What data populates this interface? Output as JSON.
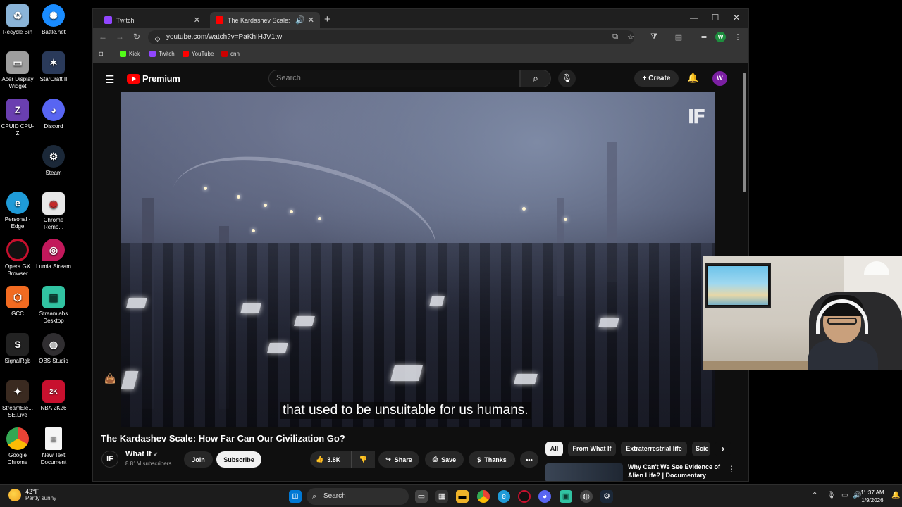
{
  "desktop": {
    "icons_left": [
      {
        "label": "Recycle Bin",
        "icon": "recycle-bin-icon",
        "color": "#8ab4d8"
      },
      {
        "label": "Acer Display Widget",
        "icon": "acer-display-widget-icon",
        "color": "#9e9e9e"
      },
      {
        "label": "CPUID CPU-Z",
        "icon": "cpuz-icon",
        "color": "#6a3fb0"
      },
      {
        "label": "Personal - Edge",
        "icon": "edge-icon",
        "color": "#1f9bd8"
      },
      {
        "label": "Opera GX Browser",
        "icon": "opera-gx-icon",
        "color": "#c8102e"
      },
      {
        "label": "GCC",
        "icon": "gcc-icon",
        "color": "#f26b21"
      },
      {
        "label": "SignalRgb",
        "icon": "signalrgb-icon",
        "color": "#222222"
      },
      {
        "label": "StreamEle... SE.Live",
        "icon": "streamelements-icon",
        "color": "#3a2a20"
      },
      {
        "label": "Google Chrome",
        "icon": "chrome-icon",
        "color": "#4285f4"
      }
    ],
    "icons_right": [
      {
        "label": "Battle.net",
        "icon": "battlenet-icon",
        "color": "#1a8cff"
      },
      {
        "label": "StarCraft II",
        "icon": "starcraft-icon",
        "color": "#2a3a5a"
      },
      {
        "label": "Discord",
        "icon": "discord-icon",
        "color": "#5865f2"
      },
      {
        "label": "Steam",
        "icon": "steam-icon",
        "color": "#1b2838"
      },
      {
        "label": "Chrome Remo...",
        "icon": "chrome-remote-icon",
        "color": "#e8e8e8"
      },
      {
        "label": "Lumia Stream",
        "icon": "lumia-stream-icon",
        "color": "#c2185b"
      },
      {
        "label": "Streamlabs Desktop",
        "icon": "streamlabs-icon",
        "color": "#31c3a2"
      },
      {
        "label": "OBS Studio",
        "icon": "obs-icon",
        "color": "#302e31"
      },
      {
        "label": "NBA 2K26",
        "icon": "nba2k-icon",
        "color": "#c8102e"
      },
      {
        "label": "New Text Document",
        "icon": "text-document-icon",
        "color": "#f5f5f5"
      }
    ]
  },
  "browser": {
    "tabs": [
      {
        "title": "Twitch",
        "icon_color": "#9146ff"
      },
      {
        "title": "The Kardashev Scale: How F",
        "icon_color": "#ff0000"
      }
    ],
    "url": "youtube.com/watch?v=PaKhIHJV1tw",
    "bookmarks": [
      {
        "label": "Kick",
        "color": "#53fc18"
      },
      {
        "label": "Twitch",
        "color": "#9146ff"
      },
      {
        "label": "YouTube",
        "color": "#ff0000"
      },
      {
        "label": "cnn",
        "color": "#cc0000"
      }
    ],
    "profile_initial": "W"
  },
  "youtube": {
    "logo_text": "Premium",
    "search_placeholder": "Search",
    "create_label": "Create",
    "avatar_initial": "W",
    "caption": "that used to be unsuitable for us humans.",
    "watermark": "IF",
    "video_title": "The Kardashev Scale: How Far Can Our Civilization Go?",
    "channel": {
      "avatar_text": "IF",
      "name": "What If",
      "subscribers": "8.81M subscribers",
      "join_label": "Join",
      "subscribe_label": "Subscribe"
    },
    "actions": {
      "likes": "3.8K",
      "share": "Share",
      "save": "Save",
      "thanks": "Thanks",
      "more": "•••"
    },
    "chips": [
      "All",
      "From What If",
      "Extraterrestrial life",
      "Scie"
    ],
    "recommendation": {
      "title": "Why Can't We See Evidence of Alien Life? | Documentary"
    }
  },
  "taskbar": {
    "weather_temp": "42°F",
    "weather_desc": "Partly sunny",
    "search_label": "Search",
    "time": "11:37 AM",
    "date": "1/9/2026",
    "accent": "#0078d4"
  }
}
